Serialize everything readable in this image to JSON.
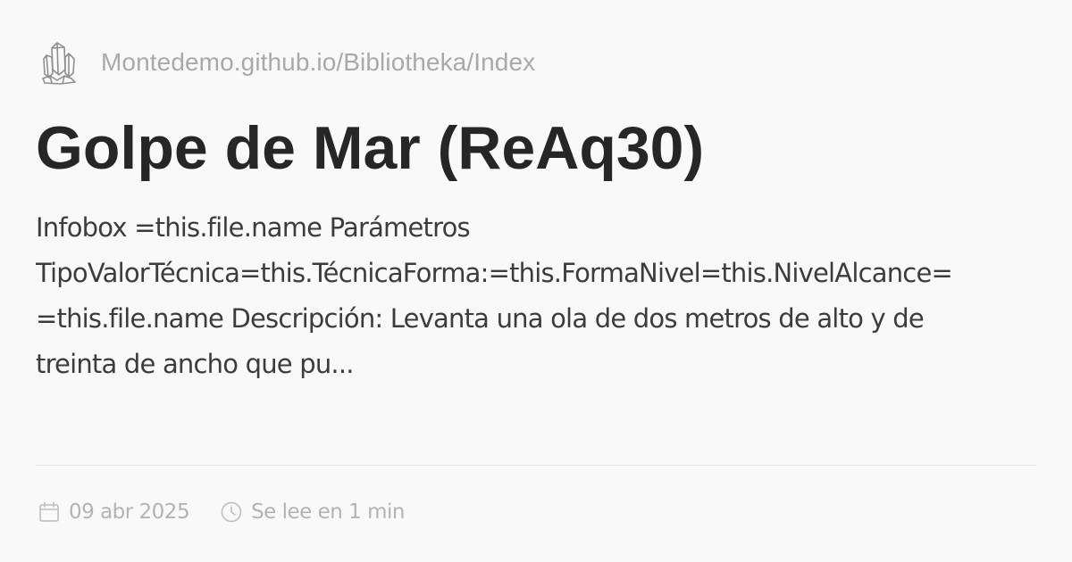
{
  "site": {
    "url": "Montedemo.github.io/Bibliotheka/Index",
    "logo_icon": "crystal-cluster-icon"
  },
  "page": {
    "title": "Golpe de Mar (ReAq30)",
    "description_lines": [
      "Infobox =this.file.name Parámetros",
      "TipoValorTécnica=this.TécnicaForma:=this.FormaNivel=this.NivelAlcance=",
      "=this.file.name Descripción: Levanta una ola de dos metros de alto y de",
      "treinta de ancho que pu..."
    ]
  },
  "meta": {
    "date": "09 abr 2025",
    "date_icon": "calendar-icon",
    "reading_time": "Se lee en 1 min",
    "reading_icon": "clock-icon"
  },
  "colors": {
    "background": "#faf9fa",
    "title": "#262626",
    "muted": "#a9a9ab",
    "divider": "#e8e6e8"
  }
}
